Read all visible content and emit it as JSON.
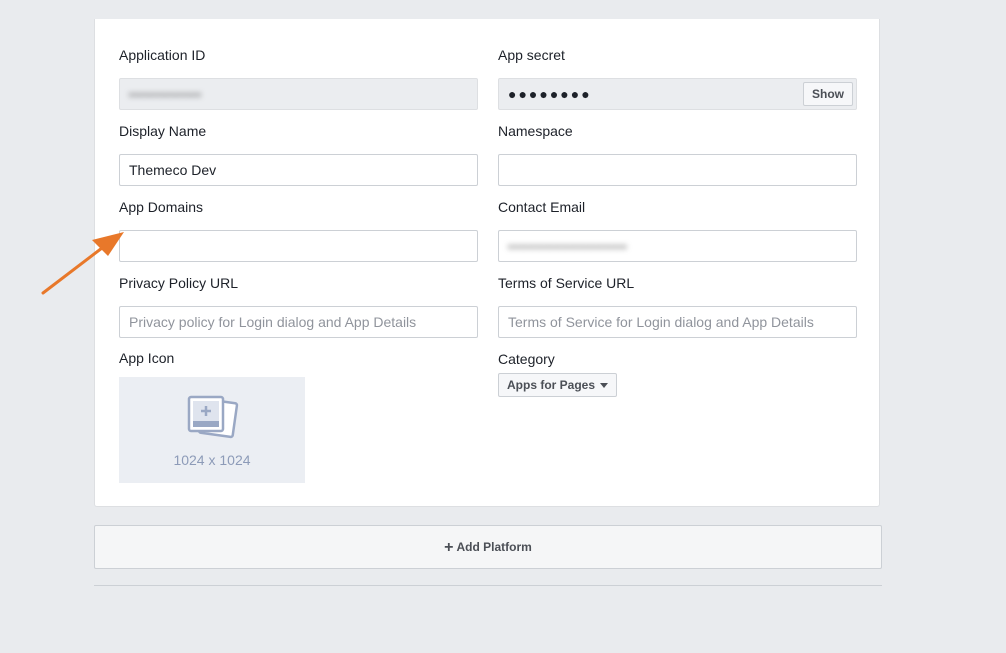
{
  "form": {
    "application_id": {
      "label": "Application ID",
      "value": "••••••••••••••"
    },
    "app_secret": {
      "label": "App secret",
      "value": "●●●●●●●●",
      "show_label": "Show"
    },
    "display_name": {
      "label": "Display Name",
      "value": "Themeco Dev"
    },
    "namespace": {
      "label": "Namespace",
      "value": ""
    },
    "app_domains": {
      "label": "App Domains",
      "value": ""
    },
    "contact_email": {
      "label": "Contact Email",
      "value": "•••••••••••••••••••••••"
    },
    "privacy_policy_url": {
      "label": "Privacy Policy URL",
      "placeholder": "Privacy policy for Login dialog and App Details"
    },
    "terms_of_service_url": {
      "label": "Terms of Service URL",
      "placeholder": "Terms of Service for Login dialog and App Details"
    },
    "app_icon": {
      "label": "App Icon",
      "size_text": "1024 x 1024"
    },
    "category": {
      "label": "Category",
      "selected": "Apps for Pages"
    }
  },
  "add_platform": {
    "label": "Add Platform"
  },
  "colors": {
    "annotation_arrow": "#e8782a",
    "icon_tint": "#9aa8c4"
  }
}
